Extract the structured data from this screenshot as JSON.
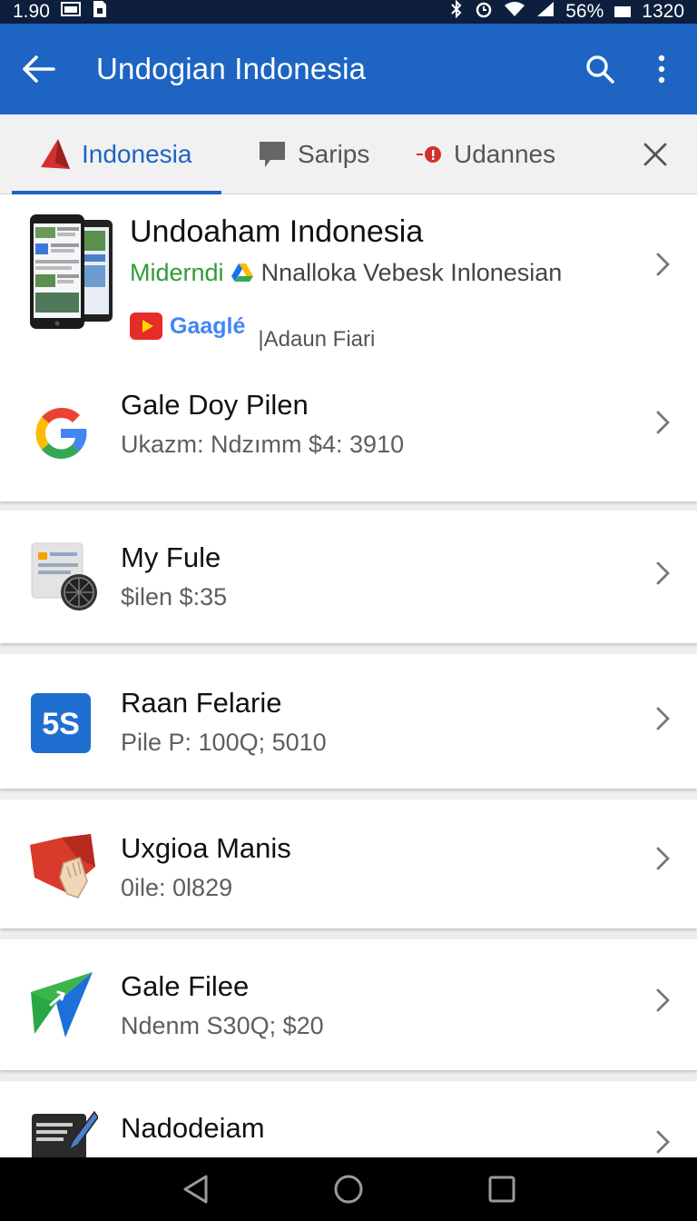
{
  "status_bar": {
    "left_text": "1.90",
    "battery_text": "56%",
    "time": "1320",
    "icons": [
      "image-icon",
      "sim-icon",
      "bluetooth-icon",
      "alarm-icon",
      "wifi-icon",
      "signal-icon",
      "battery-icon"
    ]
  },
  "app_bar": {
    "title": "Undogian Indonesia",
    "background": "#1d64c3"
  },
  "tabs": [
    {
      "label": "Indonesia",
      "icon": "red-arrow-icon",
      "active": true
    },
    {
      "label": "Sarips",
      "icon": "comment-icon",
      "active": false
    },
    {
      "label": "Udannes",
      "icon": "red-dot-icon",
      "active": false
    }
  ],
  "featured": {
    "name": "Undoaham Indonesia",
    "sub_green": "Miderndi",
    "sub_rest": "Nnalloka Vebesk Inlonesian",
    "brand": "Gaaglé",
    "brand_caption": "|Adaun Fiari"
  },
  "items": [
    {
      "name": "Gale Doy Pilen",
      "sub": "Ukazm: Ndzımm $4: 3910",
      "icon": "google-g-icon"
    },
    {
      "name": "My Fule",
      "sub": "$ilen $:35",
      "icon": "file-icon"
    },
    {
      "name": "Raan Felarie",
      "sub": "Pile P: 100Q; 5010",
      "icon": "5s-icon",
      "badge": "5S"
    },
    {
      "name": "Uxgioa Manis",
      "sub": "0ile: 0l829",
      "icon": "red-hand-icon"
    },
    {
      "name": "Gale Filee",
      "sub": "Ndenm S30Q; $20",
      "icon": "green-arrow-icon"
    },
    {
      "name": "Nadodeiam",
      "sub": "",
      "icon": "notepad-icon"
    }
  ]
}
